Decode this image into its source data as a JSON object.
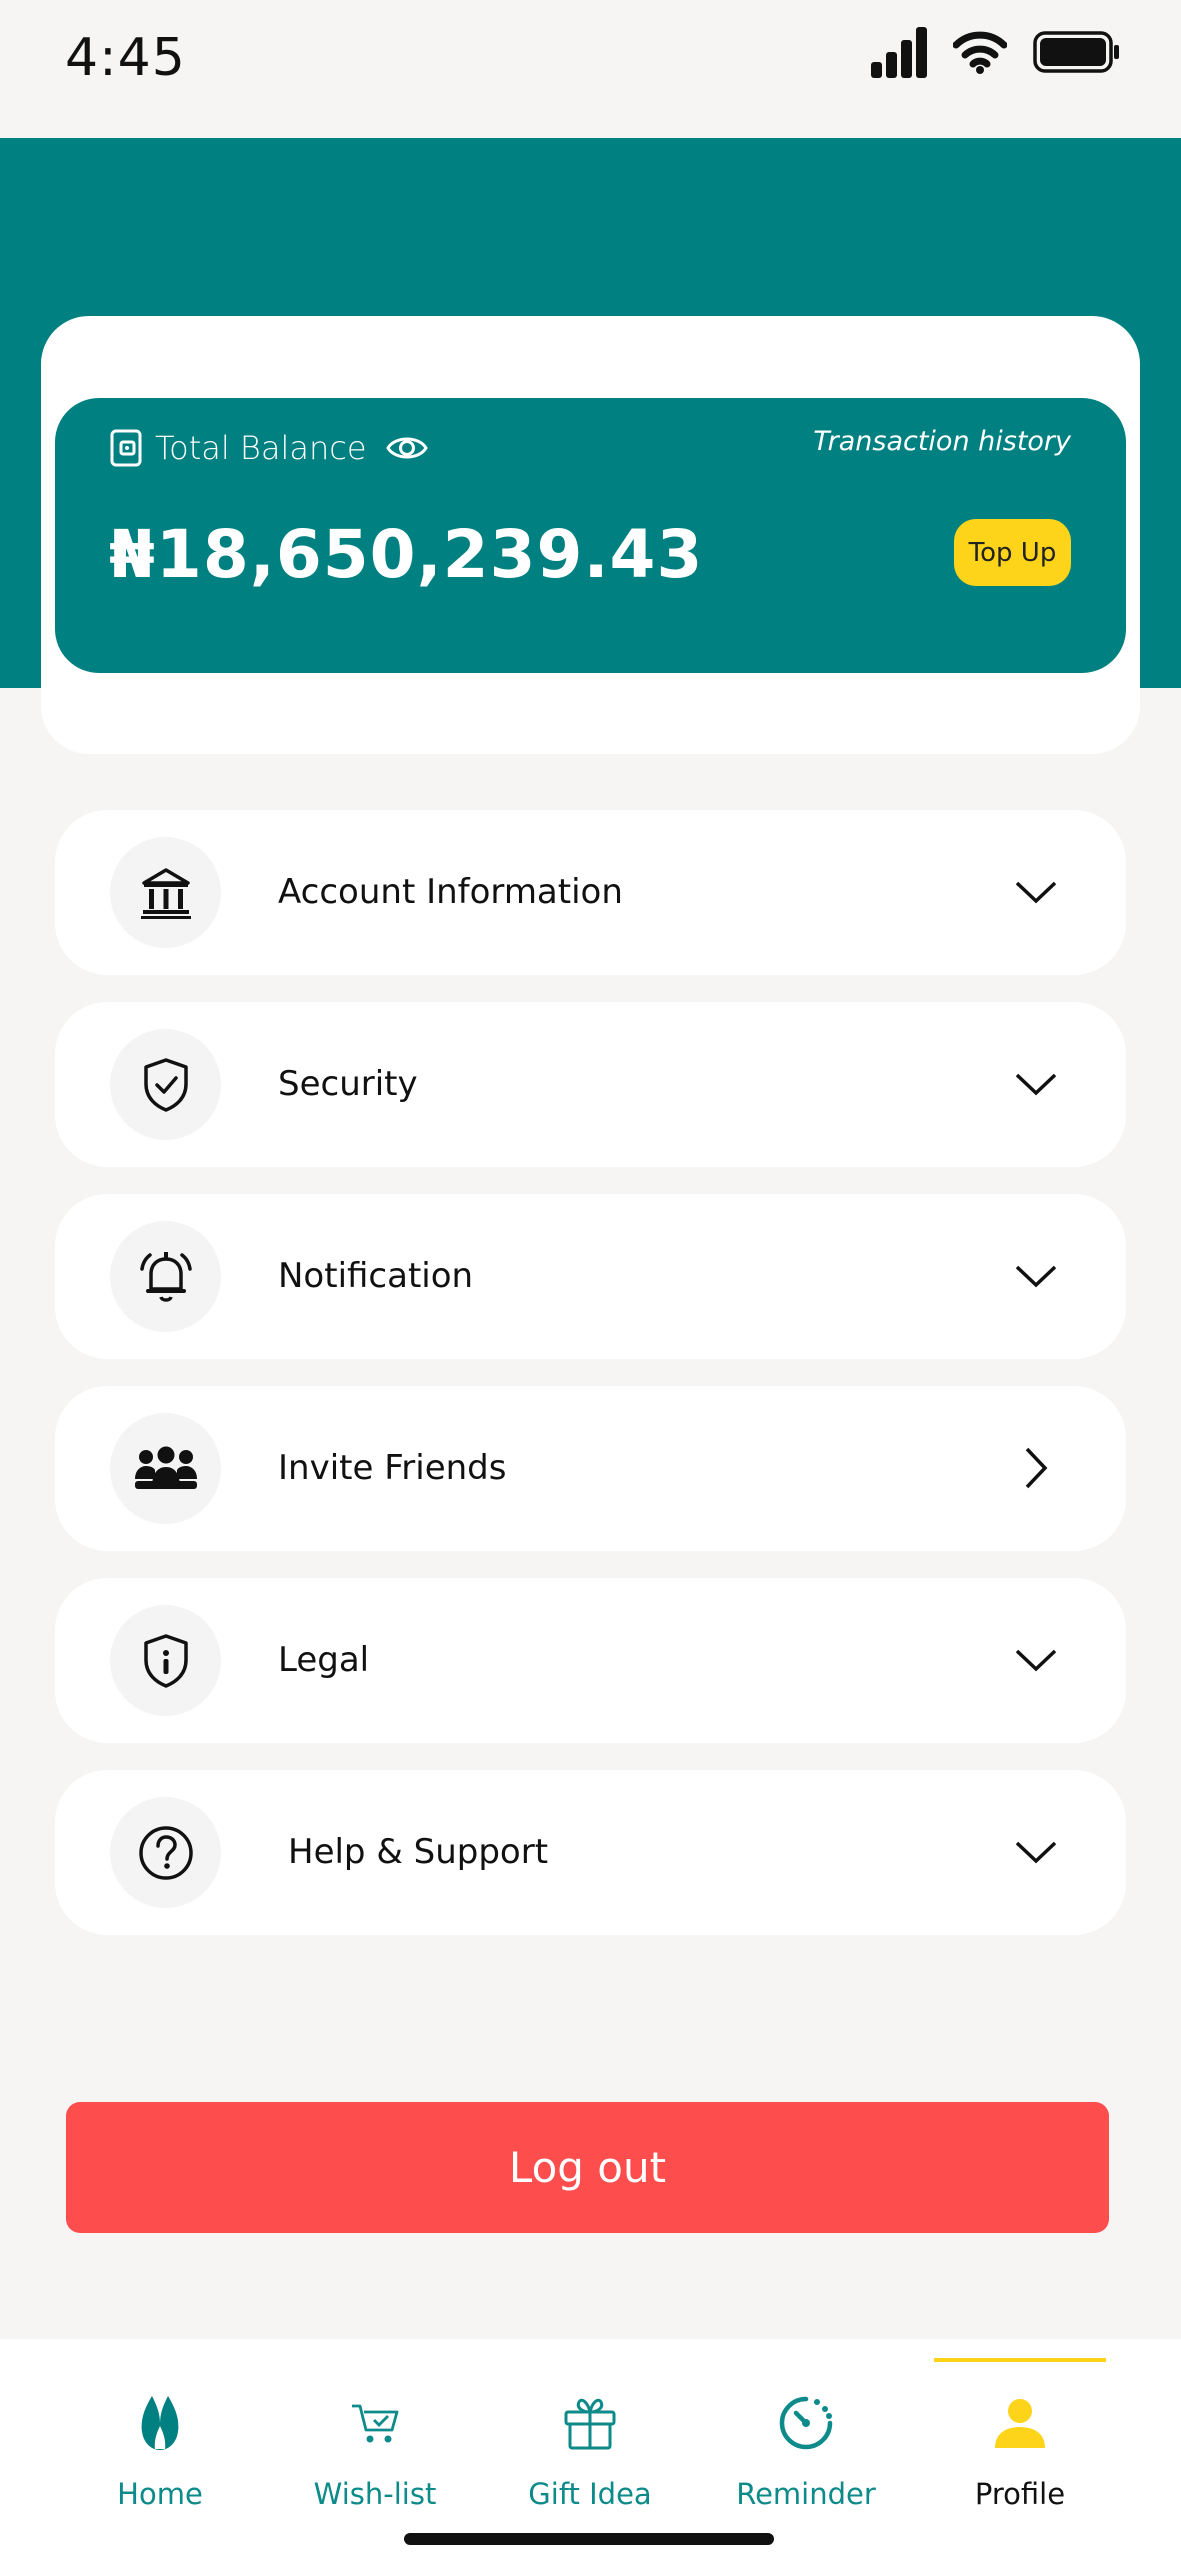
{
  "status_bar": {
    "time": "4:45"
  },
  "balance": {
    "label": "Total Balance",
    "transaction_history": "Transaction history",
    "amount": "₦18,650,239.43",
    "top_up": "Top Up"
  },
  "menu": [
    {
      "label": "Account Information",
      "icon": "bank-icon",
      "chevron": "chevron-down-icon"
    },
    {
      "label": "Security",
      "icon": "shield-check-icon",
      "chevron": "chevron-down-icon"
    },
    {
      "label": "Notification",
      "icon": "bell-icon",
      "chevron": "chevron-down-icon"
    },
    {
      "label": "Invite Friends",
      "icon": "people-icon",
      "chevron": "chevron-right-icon"
    },
    {
      "label": "Legal",
      "icon": "shield-info-icon",
      "chevron": "chevron-down-icon"
    },
    {
      "label": "Help & Support",
      "icon": "question-circle-icon",
      "chevron": "chevron-down-icon"
    }
  ],
  "logout": "Log out",
  "nav": [
    {
      "label": "Home",
      "icon": "home-icon"
    },
    {
      "label": "Wish-list",
      "icon": "wishlist-icon"
    },
    {
      "label": "Gift Idea",
      "icon": "gift-icon"
    },
    {
      "label": "Reminder",
      "icon": "reminder-icon"
    },
    {
      "label": "Profile",
      "icon": "profile-icon",
      "active": true
    }
  ],
  "colors": {
    "teal": "#008080",
    "accent_yellow": "#fdd41a",
    "logout_red": "#fd4d4d",
    "background": "#f6f5f3"
  }
}
